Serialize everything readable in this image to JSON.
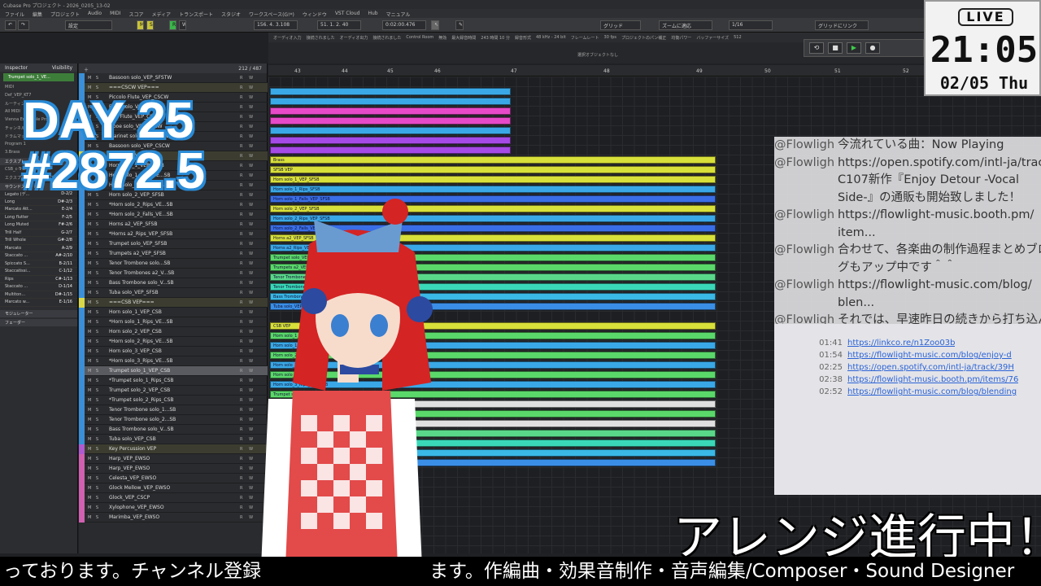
{
  "window": {
    "title": "Cubase Pro プロジェクト - 2026_0205_13-02"
  },
  "menu": [
    "ファイル",
    "編集",
    "プロジェクト",
    "Audio",
    "MIDI",
    "スコア",
    "メディア",
    "トランスポート",
    "スタジオ",
    "ワークスペース(G!*)",
    "ウィンドウ",
    "VST Cloud",
    "Hub",
    "マニュアル"
  ],
  "toolbar": {
    "preset": "設定",
    "position": "156. 4. 3.108",
    "position2": "51. 1. 2. 40",
    "time": "0:02:00.476",
    "grid": "グリッド",
    "zoom": "ズームに適応",
    "quant": "1/16",
    "link": "グリッドにリンク"
  },
  "statusbar": [
    "オーディオ入力",
    "接続されました",
    "オーディオ出力",
    "接続されました",
    "Control Room",
    "無効",
    "最大録音時間",
    "243 時間 10 分",
    "録音形式",
    "48 kHz - 24 bit",
    "フレームレート",
    "30 fps",
    "プロジェクトのパン補正",
    "均衡パワー",
    "バッファーサイズ",
    "512"
  ],
  "info_line": "選択オブジェクトなし",
  "inspector": {
    "tabs": [
      "Inspector",
      "Visibility"
    ],
    "track": "Trumpet solo_1_VE...",
    "rows": [
      "MIDI",
      "Def_VEP_KT7",
      "ルーティング",
      "All MIDI",
      "Vienna Ensemble Pro",
      "チャンネル 1",
      "ドラムマップなし",
      "Program 1",
      "3.Brass"
    ],
    "expression_header": "エクスプレッションマップ",
    "expression_map": "CSB_c-Trumpet solo_...",
    "expression_setup": "エクスプレッションマップ設定",
    "slot_header": "サウンドスロット",
    "slots": [
      {
        "name": "Legato (デ...",
        "key": "D-2/2"
      },
      {
        "name": "Long",
        "key": "D#-2/3"
      },
      {
        "name": "Marcato Att...",
        "key": "E-2/4"
      },
      {
        "name": "Long flutter",
        "key": "F-2/5"
      },
      {
        "name": "Long Muted",
        "key": "F#-2/6"
      },
      {
        "name": "Trill Half",
        "key": "G-2/7"
      },
      {
        "name": "Trill Whole",
        "key": "G#-2/8"
      },
      {
        "name": "Marcato",
        "key": "A-2/9"
      },
      {
        "name": "Staccato ...",
        "key": "A#-2/10"
      },
      {
        "name": "Spiccato S...",
        "key": "B-2/11"
      },
      {
        "name": "Staccatissi...",
        "key": "C-1/12"
      },
      {
        "name": "Rips",
        "key": "C#-1/13"
      },
      {
        "name": "Staccato ...",
        "key": "D-1/14"
      },
      {
        "name": "Multiton...",
        "key": "D#-1/15"
      },
      {
        "name": "Marcato w...",
        "key": "E-1/16"
      }
    ],
    "modulator": "モジュレーター",
    "fader": "フェーダー"
  },
  "tracklist": {
    "counter": "212 / 487",
    "tracks": [
      {
        "name": "Bassoon solo_VEP_SFSTW",
        "color": "#3a8fd6",
        "kind": "track"
      },
      {
        "name": "===CSCW VEP===",
        "color": "#3a8fd6",
        "kind": "folder"
      },
      {
        "name": "Piccolo Flute_VEP_CSCW",
        "color": "#3a8fd6",
        "kind": "track"
      },
      {
        "name": "Flute solo_VEP_CSCW",
        "color": "#3a8fd6",
        "kind": "track"
      },
      {
        "name": "Alto Flute_VEP_CSCW",
        "color": "#3a8fd6",
        "kind": "track"
      },
      {
        "name": "Oboe solo_VEP_CSCW",
        "color": "#3a8fd6",
        "kind": "track"
      },
      {
        "name": "Clarinet solo_VEP_CSCW",
        "color": "#3a8fd6",
        "kind": "track"
      },
      {
        "name": "Bassoon solo_VEP_CSCW",
        "color": "#3a8fd6",
        "kind": "track"
      },
      {
        "name": "===SFSB VEP===",
        "color": "#d8d84a",
        "kind": "folder"
      },
      {
        "name": "Horn solo_1_VEP_SFSB",
        "color": "#3a8fd6",
        "kind": "track"
      },
      {
        "name": "Horn solo_1_Rips_VE...SB",
        "color": "#3a8fd6",
        "kind": "track"
      },
      {
        "name": "Horn solo_1_Falls_VE...SB",
        "color": "#3a8fd6",
        "kind": "track"
      },
      {
        "name": "Horn solo_2_VEP_SFSB",
        "color": "#3a8fd6",
        "kind": "track"
      },
      {
        "name": "*Horn solo_2_Rips_VE...SB",
        "color": "#3a8fd6",
        "kind": "track"
      },
      {
        "name": "*Horn solo_2_Falls_VE...SB",
        "color": "#3a8fd6",
        "kind": "track"
      },
      {
        "name": "Horns a2_VEP_SFSB",
        "color": "#3a8fd6",
        "kind": "track"
      },
      {
        "name": "*Horns a2_Rips_VEP_SFSB",
        "color": "#3a8fd6",
        "kind": "track"
      },
      {
        "name": "Trumpet solo_VEP_SFSB",
        "color": "#3a8fd6",
        "kind": "track"
      },
      {
        "name": "Trumpets a2_VEP_SFSB",
        "color": "#3a8fd6",
        "kind": "track"
      },
      {
        "name": "Tenor Trombone solo...SB",
        "color": "#3a8fd6",
        "kind": "track"
      },
      {
        "name": "Tenor Trombones a2_V...SB",
        "color": "#3a8fd6",
        "kind": "track"
      },
      {
        "name": "Bass Trombone solo_V...SB",
        "color": "#3a8fd6",
        "kind": "track"
      },
      {
        "name": "Tuba solo_VEP_SFSB",
        "color": "#3a8fd6",
        "kind": "track"
      },
      {
        "name": "===CSB VEP===",
        "color": "#d8d84a",
        "kind": "folder"
      },
      {
        "name": "Horn solo_1_VEP_CSB",
        "color": "#3a8fd6",
        "kind": "track"
      },
      {
        "name": "*Horn solo_1_Rips_VE...SB",
        "color": "#3a8fd6",
        "kind": "track"
      },
      {
        "name": "Horn solo_2_VEP_CSB",
        "color": "#3a8fd6",
        "kind": "track"
      },
      {
        "name": "*Horn solo_2_Rips_VE...SB",
        "color": "#3a8fd6",
        "kind": "track"
      },
      {
        "name": "Horn solo_3_VEP_CSB",
        "color": "#3a8fd6",
        "kind": "track"
      },
      {
        "name": "*Horn solo_3_Rips_VE...SB",
        "color": "#3a8fd6",
        "kind": "track"
      },
      {
        "name": "Trumpet solo_1_VEP_CSB",
        "color": "#3a8fd6",
        "kind": "selected"
      },
      {
        "name": "*Trumpet solo_1_Rips_CSB",
        "color": "#3a8fd6",
        "kind": "track"
      },
      {
        "name": "Trumpet solo_2_VEP_CSB",
        "color": "#3a8fd6",
        "kind": "track"
      },
      {
        "name": "*Trumpet solo_2_Rips_CSB",
        "color": "#3a8fd6",
        "kind": "track"
      },
      {
        "name": "Tenor Trombone solo_1...SB",
        "color": "#3a8fd6",
        "kind": "track"
      },
      {
        "name": "Tenor Trombone solo_2...SB",
        "color": "#3a8fd6",
        "kind": "track"
      },
      {
        "name": "Bass Trombone solo_V...SB",
        "color": "#3a8fd6",
        "kind": "track"
      },
      {
        "name": "Tuba solo_VEP_CSB",
        "color": "#3a8fd6",
        "kind": "track"
      },
      {
        "name": "Key Percussion VEP",
        "color": "#b05ad0",
        "kind": "folder"
      },
      {
        "name": "Harp_VEP_EWSO",
        "color": "#d060b0",
        "kind": "track"
      },
      {
        "name": "Harp_VEP_EWSO",
        "color": "#d060b0",
        "kind": "track"
      },
      {
        "name": "Celesta_VEP_EWSO",
        "color": "#d060b0",
        "kind": "track"
      },
      {
        "name": "Glock Mellow_VEP_EWSO",
        "color": "#d060b0",
        "kind": "track"
      },
      {
        "name": "Glock_VEP_CSCP",
        "color": "#d060b0",
        "kind": "track"
      },
      {
        "name": "Xylophone_VEP_EWSO",
        "color": "#d060b0",
        "kind": "track"
      },
      {
        "name": "Marimba_VEP_EWSO",
        "color": "#d060b0",
        "kind": "track"
      }
    ]
  },
  "ruler": [
    "43",
    "44",
    "45",
    "46",
    "47",
    "48",
    "49",
    "50",
    "51",
    "52"
  ],
  "parts_labels": [
    "Brass",
    "SFSB VEP",
    "Horn solo_1_VEP_SFSB",
    "Horn solo_1_Rips_SFSB",
    "Horn solo_1_Falls_VEP_SFSB",
    "Horn solo_2_VEP_SFSB",
    "Horn solo_2_Rips_VEP_SFSB",
    "Horn solo_2_Falls_VEP_SFSB",
    "Horns a2_VEP_SFSB",
    "Horns a2_Rips_VEP_SFSB",
    "Trumpet solo_VEP_SFSB",
    "Trumpets a2_VEP_SFSB",
    "Tenor Trombone solo_VEP_SFSB",
    "Tenor Trombones a2_VEP_SFSB",
    "Bass Trombone solo_VEP_SFSB",
    "Tuba solo_VEP_SFSB",
    "CSB VEP",
    "Horn solo_1_VEP_CSB",
    "Horn solo_1_Rips_VEP_CSB",
    "Horn solo_2_VEP_CSB",
    "Horn solo_2_Rips_VEP_CSB",
    "Horn solo_3_VEP_CSB",
    "Horn solo_3_Rips_VEP_CSB",
    "Trumpet solo_1_VEP_CSB",
    "Trumpet solo_1_Rips_CSB",
    "Trumpet solo_2_VEP_CSB",
    "Trumpet solo_2_Rips_CSB",
    "Tenor Trombone solo_1_VEP_CSB",
    "Tenor Trombone solo_2_VEP_CSB",
    "Bass Trombone solo_VEP_CSB",
    "Tuba solo_VEP_CSB"
  ],
  "overlay": {
    "day": "DAY 25",
    "count": "#2872.5"
  },
  "clock": {
    "live": "LIVE",
    "time": "21:05",
    "date": "02/05 Thu"
  },
  "chat": [
    {
      "who": "@Flowligh",
      "text": "今流れている曲：Now Playing"
    },
    {
      "who": "@Flowligh",
      "text": "https://open.spotify.com/intl-ja/track"
    },
    {
      "who": "",
      "text": "C107新作『Enjoy Detour -Vocal"
    },
    {
      "who": "",
      "text": "Side-』の通販も開始致しました！"
    },
    {
      "who": "@Flowligh",
      "text": "https://flowlight-music.booth.pm/"
    },
    {
      "who": "",
      "text": "item..."
    },
    {
      "who": "@Flowligh",
      "text": "合わせて、各楽曲の制作過程まとめブロ"
    },
    {
      "who": "",
      "text": "グもアップ中です＾＾"
    },
    {
      "who": "@Flowligh",
      "text": "https://flowlight-music.com/blog/"
    },
    {
      "who": "",
      "text": "blen..."
    },
    {
      "who": "@Flowligh",
      "text": "それでは、早速昨日の続きから打ち込ん"
    },
    {
      "who": "",
      "text": "で行きましょう〜〜^^"
    }
  ],
  "links": [
    {
      "t": "01:41",
      "u": "https://linkco.re/n1Zoo03b"
    },
    {
      "t": "01:54",
      "u": "https://flowlight-music.com/blog/enjoy-d"
    },
    {
      "t": "02:25",
      "u": "https://open.spotify.com/intl-ja/track/39H"
    },
    {
      "t": "02:38",
      "u": "https://flowlight-music.booth.pm/items/76"
    },
    {
      "t": "02:52",
      "u": "https://flowlight-music.com/blog/blending"
    }
  ],
  "caption": "アレンジ進行中！",
  "ticker": "っております。チャンネル登録　　　　　　　　　ます。作編曲・効果音制作・音声編集/Composer・Sound Designer"
}
